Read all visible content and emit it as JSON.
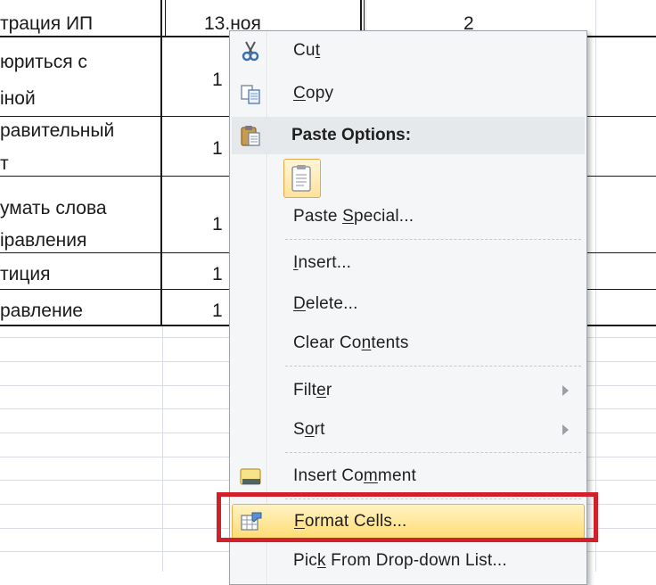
{
  "spreadsheet": {
    "col_a": [
      "трация ИП",
      "юриться с",
      "іной",
      "равительный",
      "т",
      "умать слова",
      "іравления",
      "тиция",
      "равление"
    ],
    "col_b": [
      "13.ноя",
      "1",
      "1",
      "1",
      "1",
      "1"
    ],
    "col_c": [
      "2"
    ]
  },
  "context_menu": {
    "items": [
      {
        "pre": "Cu",
        "key": "t",
        "post": "",
        "icon": "scissors-icon"
      },
      {
        "pre": "",
        "key": "C",
        "post": "opy",
        "icon": "copy-icon"
      },
      {
        "header": "Paste Options:",
        "icon": "clipboard-icon"
      },
      {
        "pre": "Paste ",
        "key": "S",
        "post": "pecial...",
        "icon": ""
      },
      {
        "pre": "",
        "key": "I",
        "post": "nsert...",
        "icon": ""
      },
      {
        "pre": "",
        "key": "D",
        "post": "elete...",
        "icon": ""
      },
      {
        "pre": "Clear Co",
        "key": "n",
        "post": "tents",
        "icon": ""
      },
      {
        "pre": "Filt",
        "key": "e",
        "post": "r",
        "icon": "",
        "submenu": true
      },
      {
        "pre": "S",
        "key": "o",
        "post": "rt",
        "icon": "",
        "submenu": true
      },
      {
        "pre": "Insert Co",
        "key": "m",
        "post": "ment",
        "icon": "comment-icon"
      },
      {
        "pre": "",
        "key": "F",
        "post": "ormat Cells...",
        "icon": "format-cells-icon",
        "highlighted": true
      },
      {
        "pre": "Pic",
        "key": "k",
        "post": " From Drop-down List...",
        "icon": ""
      }
    ]
  },
  "colors": {
    "highlight_border": "#e7b24d",
    "annotation_red": "#d0202a",
    "menu_bg": "#f5f6f7"
  }
}
